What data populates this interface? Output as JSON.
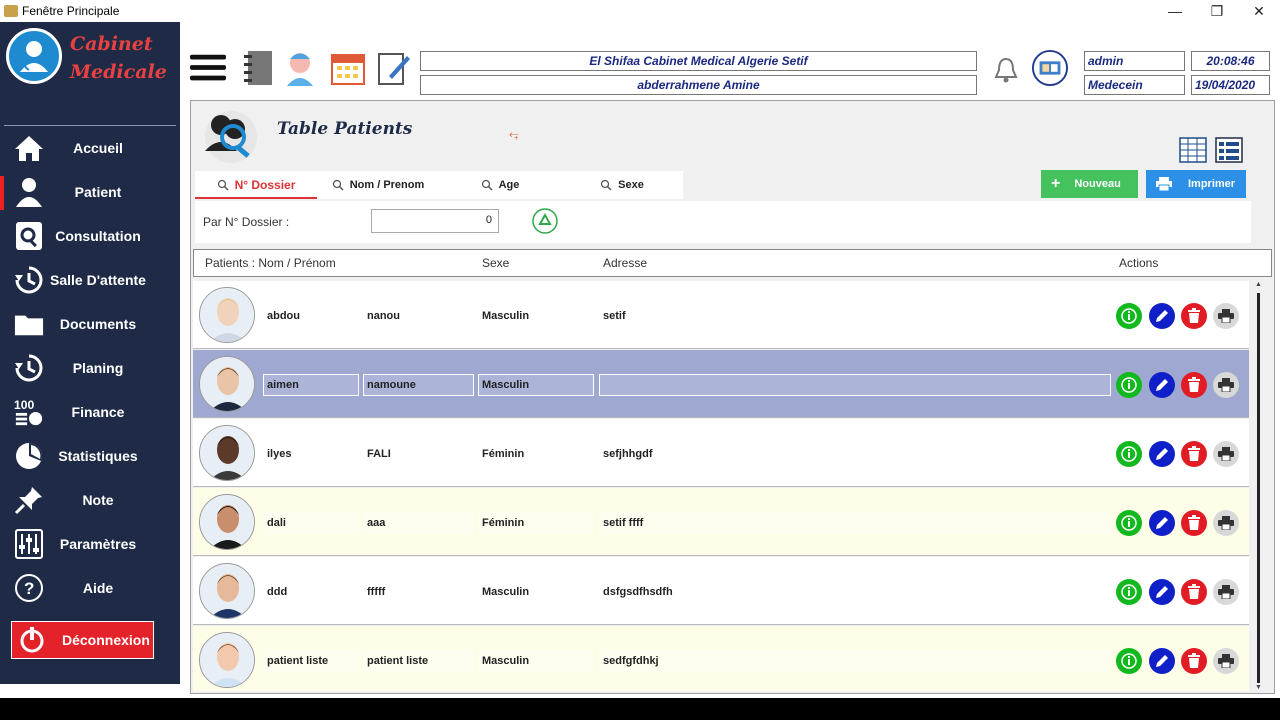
{
  "window": {
    "title": "Fenêtre Principale"
  },
  "sidebar": {
    "logo_line1": "Cabinet",
    "logo_line2": "Medicale",
    "items": [
      {
        "label": "Accueil",
        "icon": "home-icon"
      },
      {
        "label": "Patient",
        "icon": "user-icon"
      },
      {
        "label": "Consultation",
        "icon": "magnifier-icon"
      },
      {
        "label": "Salle D'attente",
        "icon": "clock-arrow-icon"
      },
      {
        "label": "Documents",
        "icon": "folder-icon"
      },
      {
        "label": "Planing",
        "icon": "clock-arrow-icon"
      },
      {
        "label": "Finance",
        "icon": "coins-icon"
      },
      {
        "label": "Statistiques",
        "icon": "pie-chart-icon"
      },
      {
        "label": "Note",
        "icon": "pin-icon"
      },
      {
        "label": "Paramètres",
        "icon": "sliders-icon"
      },
      {
        "label": "Aide",
        "icon": "help-icon"
      }
    ],
    "active_index": 1,
    "logout_label": "Déconnexion"
  },
  "header": {
    "clinic": "El Shifaa Cabinet Medical   Algerie Setif",
    "doctor": "abderrahmene   Amine",
    "user": "admin",
    "role": "Medecein",
    "time": "20:08:46",
    "date": "19/04/2020"
  },
  "content": {
    "title": "Table Patients",
    "tabs": [
      "N° Dossier",
      "Nom / Prenom",
      "Age",
      "Sexe"
    ],
    "active_tab": 0,
    "filter_label": "Par N° Dossier :",
    "filter_value": "0",
    "new_label": "Nouveau",
    "print_label": "Imprimer",
    "columns": [
      "Patients : Nom / Prénom",
      "Sexe",
      "Adresse",
      "Actions"
    ]
  },
  "patients": [
    {
      "nom": "abdou",
      "prenom": "nanou",
      "sexe": "Masculin",
      "adresse": "setif"
    },
    {
      "nom": "aimen",
      "prenom": "namoune",
      "sexe": "Masculin",
      "adresse": ""
    },
    {
      "nom": "ilyes",
      "prenom": "FALI",
      "sexe": "Féminin",
      "adresse": "sefjhhgdf"
    },
    {
      "nom": "dali",
      "prenom": "aaa",
      "sexe": "Féminin",
      "adresse": "setif ffff"
    },
    {
      "nom": "ddd",
      "prenom": "fffff",
      "sexe": "Masculin",
      "adresse": "dsfgsdfhsdfh"
    },
    {
      "nom": "patient liste",
      "prenom": "patient liste",
      "sexe": "Masculin",
      "adresse": "sedfgfdhkj"
    }
  ],
  "colors": {
    "sidebar": "#1f2b46",
    "accent_red": "#e3222a",
    "row_selected": "#9ea8d0",
    "row_alt": "#fefde8"
  }
}
